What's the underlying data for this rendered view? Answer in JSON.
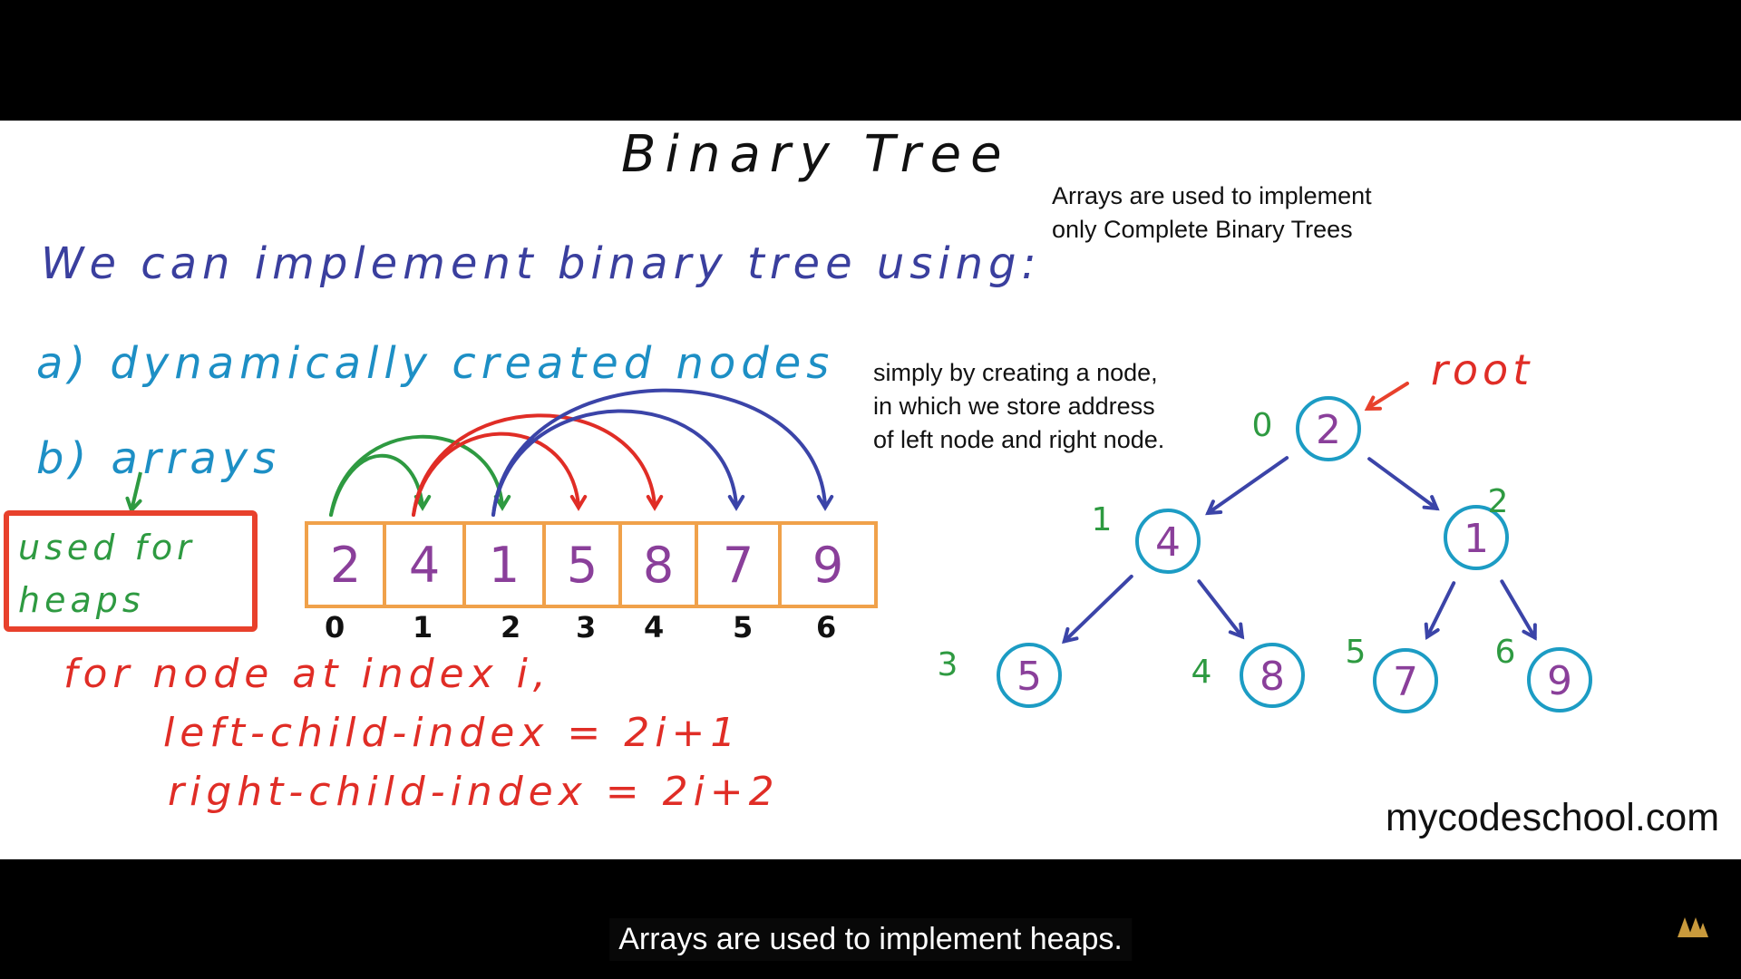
{
  "slide": {
    "title": "Binary Tree",
    "intro": "We can implement binary tree using:",
    "option_a": "a) dynamically created nodes",
    "option_b": "b) arrays",
    "heap_note": "used for\nheaps",
    "rule_line1": "for node at index i,",
    "rule_line2": "left-child-index = 2i+1",
    "rule_line3": "right-child-index = 2i+2",
    "note_complete": "Arrays are used to implement only Complete Binary Trees",
    "note_nodes": "simply by creating a node, in which we store address of left node and right node.",
    "root_label": "root",
    "website": "mycodeschool.com",
    "array_values": [
      "2",
      "4",
      "1",
      "5",
      "8",
      "7",
      "9"
    ],
    "array_indices": [
      "0",
      "1",
      "2",
      "3",
      "4",
      "5",
      "6"
    ],
    "tree_nodes": [
      {
        "value": "2",
        "index": "0"
      },
      {
        "value": "4",
        "index": "1"
      },
      {
        "value": "1",
        "index": "2"
      },
      {
        "value": "5",
        "index": "3"
      },
      {
        "value": "8",
        "index": "4"
      },
      {
        "value": "7",
        "index": "5"
      },
      {
        "value": "9",
        "index": "6"
      }
    ]
  },
  "player": {
    "caption": "Arrays are used to implement heaps.",
    "logo_icon": "channel-logo-icon"
  },
  "colors": {
    "node_stroke": "#1c9cc4",
    "node_text": "#8a3f9a",
    "index_text": "#2e9a41",
    "tree_arrow": "#3b44a8",
    "root_arrow": "#e8412c",
    "array_border": "#f0a14a",
    "heap_box": "#e8412c"
  }
}
